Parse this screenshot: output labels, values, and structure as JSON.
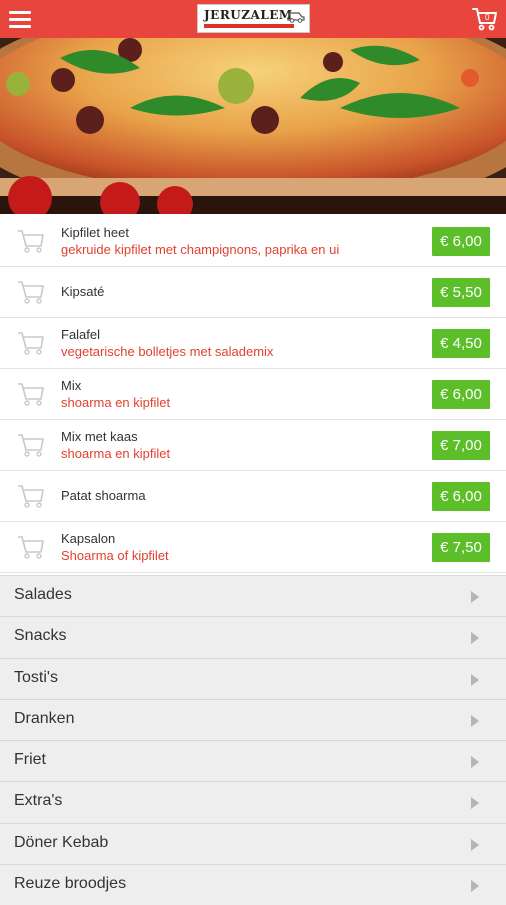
{
  "header": {
    "logo_text": "JERUZALEM",
    "menu_icon": "hamburger-menu-icon",
    "cart_icon": "shopping-cart-icon",
    "bar_color": "#e8453c"
  },
  "items": [
    {
      "name": "Kipfilet heet",
      "desc": "gekruide kipfilet met champignons, paprika en ui",
      "price": "€ 6,00"
    },
    {
      "name": "Kipsaté",
      "desc": "",
      "price": "€ 5,50"
    },
    {
      "name": "Falafel",
      "desc": "vegetarische bolletjes met salademix",
      "price": "€ 4,50"
    },
    {
      "name": "Mix",
      "desc": "shoarma en kipfilet",
      "price": "€ 6,00"
    },
    {
      "name": "Mix met kaas",
      "desc": "shoarma en kipfilet",
      "price": "€ 7,00"
    },
    {
      "name": "Patat shoarma",
      "desc": "",
      "price": "€ 6,00"
    },
    {
      "name": "Kapsalon",
      "desc": "Shoarma of kipfilet",
      "price": "€ 7,50"
    }
  ],
  "categories": [
    {
      "label": "Salades"
    },
    {
      "label": "Snacks"
    },
    {
      "label": "Tosti's"
    },
    {
      "label": "Dranken"
    },
    {
      "label": "Friet"
    },
    {
      "label": "Extra's"
    },
    {
      "label": "Döner Kebab"
    },
    {
      "label": "Reuze broodjes"
    }
  ],
  "colors": {
    "accent": "#e8453c",
    "price_badge": "#5cbf2a",
    "description": "#e2412f",
    "category_bg": "#eeeeee"
  }
}
